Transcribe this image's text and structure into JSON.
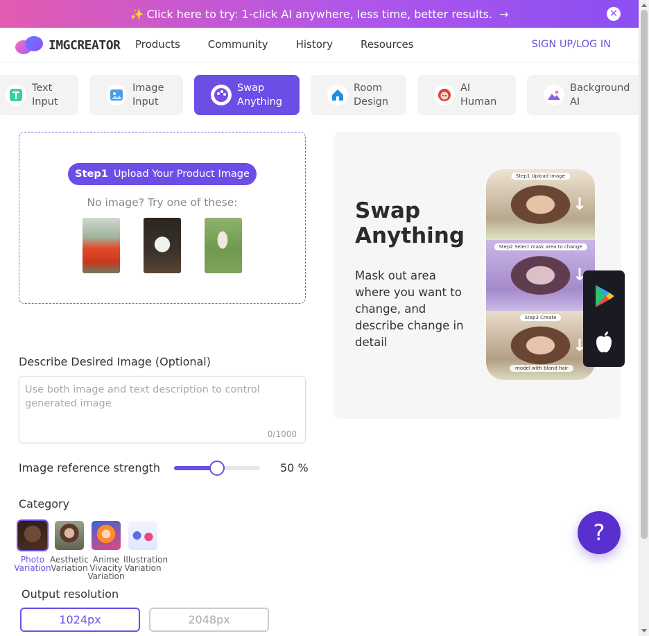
{
  "promo": {
    "text": "Click here to try: 1-click AI anywhere, less time, better results.",
    "sparkle": "✨",
    "arrow": "→",
    "close": "✕"
  },
  "header": {
    "logo_text": "IMGCREATOR",
    "nav": [
      "Products",
      "Community",
      "History",
      "Resources"
    ],
    "signup": "SIGN UP/LOG IN"
  },
  "tabs": [
    {
      "label": "Text\nInput",
      "icon": "text-icon",
      "active": false
    },
    {
      "label": "Image\nInput",
      "icon": "image-icon",
      "active": false
    },
    {
      "label": "Swap\nAnything",
      "icon": "palette-icon",
      "active": true
    },
    {
      "label": "Room\nDesign",
      "icon": "house-icon",
      "active": false
    },
    {
      "label": "AI\nHuman",
      "icon": "face-icon",
      "active": false
    },
    {
      "label": "Background\nAI",
      "icon": "landscape-icon",
      "active": false
    }
  ],
  "upload": {
    "step": "Step1",
    "label": "Upload Your Product Image",
    "no_image_text": "No image? Try one of these:"
  },
  "describe": {
    "label": "Describe Desired Image (Optional)",
    "placeholder": "Use both image and text description to control generated image",
    "count": "0/1000"
  },
  "strength": {
    "label": "Image reference strength",
    "value": 50,
    "value_text": "50 %"
  },
  "category": {
    "label": "Category",
    "items": [
      {
        "label": "Photo\nVariation",
        "active": true
      },
      {
        "label": "Aesthetic\nVariation",
        "active": false
      },
      {
        "label": "Anime\nVivacity\nVariation",
        "active": false
      },
      {
        "label": "Illustration\nVariation",
        "active": false
      }
    ]
  },
  "output": {
    "label": "Output resolution",
    "options": [
      "1024px",
      "2048px"
    ],
    "selected": "1024px"
  },
  "panel": {
    "title": "Swap\nAnything",
    "description": "Mask out area where you want to change, and describe change in detail",
    "steps": [
      {
        "label": "Step1  Upload image"
      },
      {
        "label": "Step2  Select mask area to change"
      },
      {
        "label": "Step3  Create"
      }
    ],
    "prompt": "model with blond hair"
  },
  "help": "?",
  "colors": {
    "accent": "#6c4de6",
    "banner_start": "#e25bb0",
    "banner_end": "#8a4ff2"
  }
}
